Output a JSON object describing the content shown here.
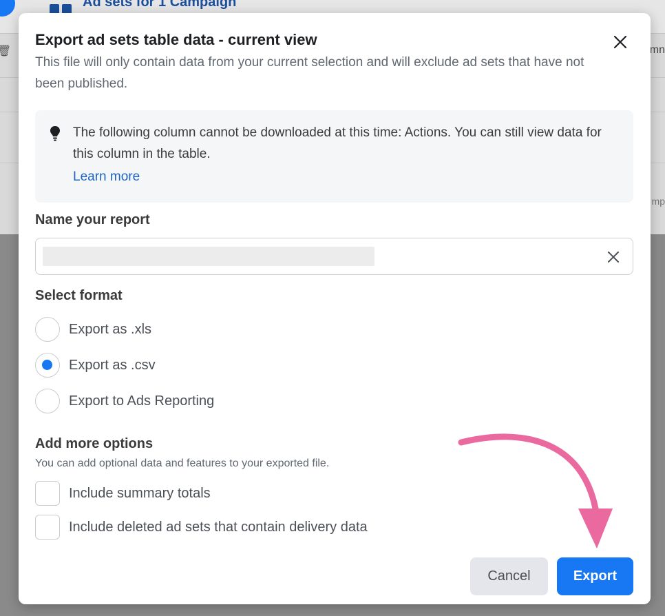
{
  "background": {
    "page_title": "Ad sets for 1 Campaign",
    "right_fragment_top": "mn",
    "right_fragment_mid": "mp"
  },
  "modal": {
    "title": "Export ad sets table data - current view",
    "subtitle": "This file will only contain data from your current selection and will exclude ad sets that have not been published.",
    "notice": {
      "text": "The following column cannot be downloaded at this time: Actions. You can still view data for this column in the table.",
      "link": "Learn more"
    },
    "report_name": {
      "label": "Name your report",
      "value": ""
    },
    "format": {
      "label": "Select format",
      "options": [
        {
          "label": "Export as .xls",
          "checked": false
        },
        {
          "label": "Export as .csv",
          "checked": true
        },
        {
          "label": "Export to Ads Reporting",
          "checked": false
        }
      ]
    },
    "more_options": {
      "label": "Add more options",
      "helper": "You can add optional data and features to your exported file.",
      "checkboxes": [
        {
          "label": "Include summary totals",
          "checked": false
        },
        {
          "label": "Include deleted ad sets that contain delivery data",
          "checked": false
        }
      ]
    },
    "buttons": {
      "cancel": "Cancel",
      "export": "Export"
    }
  },
  "colors": {
    "primary": "#1877f2",
    "link": "#1d65c1",
    "annotation_arrow": "#ea6aa0"
  }
}
